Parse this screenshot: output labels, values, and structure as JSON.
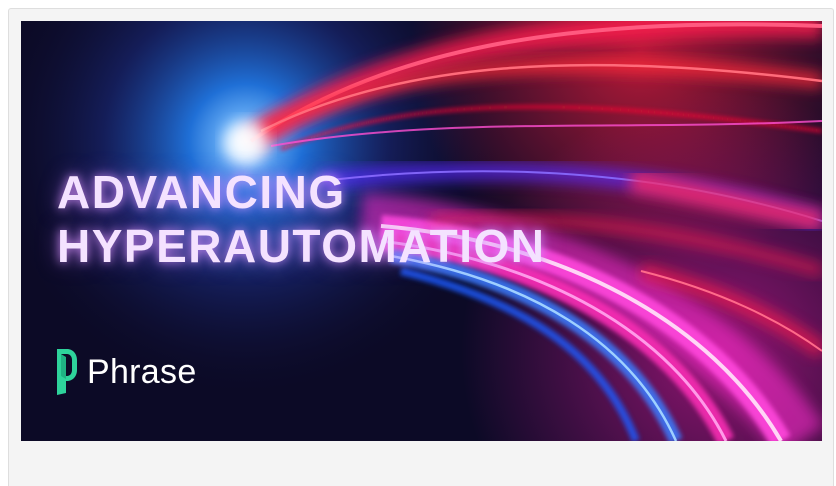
{
  "hero": {
    "headline_line1": "ADVANCING",
    "headline_line2": "HYPERAUTOMATION",
    "brand_name": "Phrase",
    "brand_icon": "phrase-logo-icon"
  },
  "colors": {
    "panel_background": "#f4f4f4",
    "hero_background": "#0c0a26",
    "headline_text": "#f4e2ff",
    "brand_green": "#2ed39b",
    "streak_red": "#ff1e50",
    "streak_magenta": "#ff2fd0",
    "streak_blue": "#2f7dff"
  }
}
